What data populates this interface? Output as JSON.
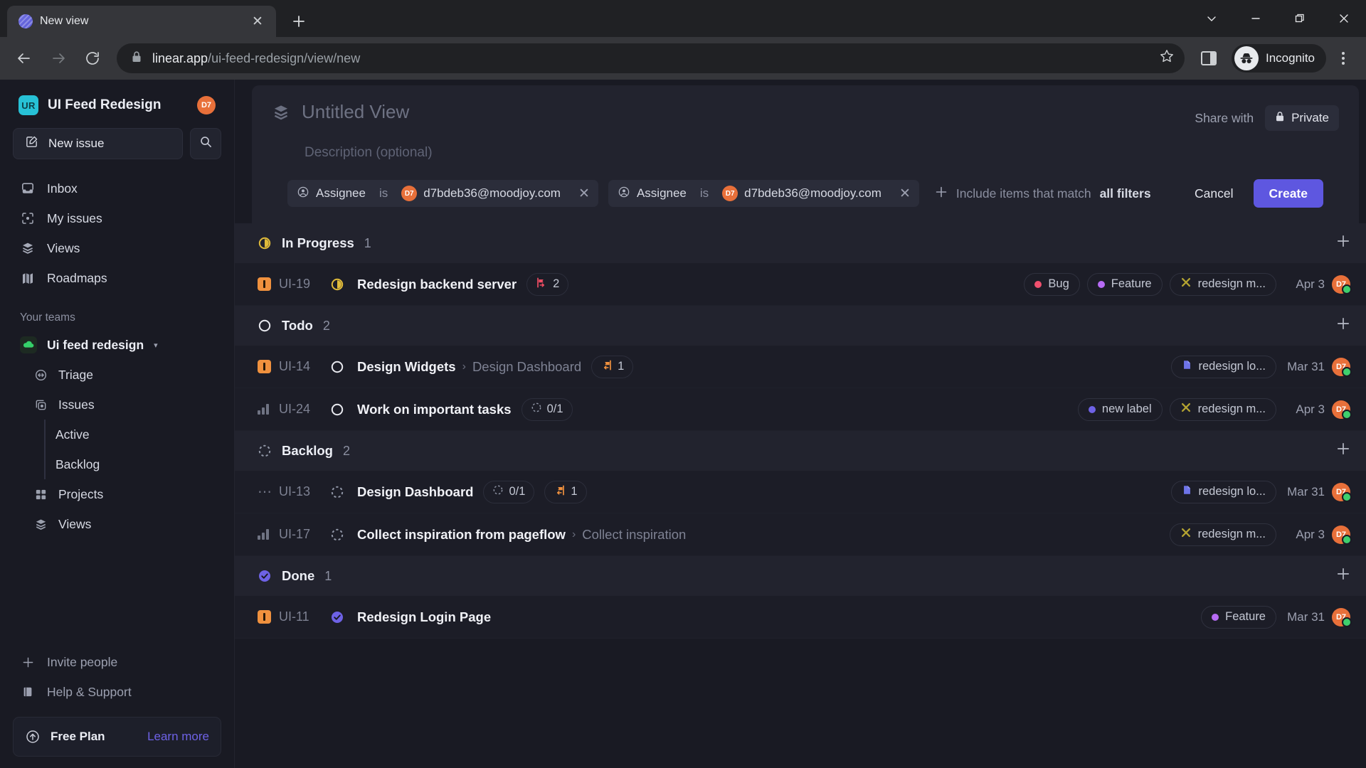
{
  "browser": {
    "tab": {
      "title": "New view",
      "favicon": "linear-favicon-icon",
      "close": "close-icon"
    },
    "newtab_label": "+",
    "window_controls": [
      "chevron-down-icon",
      "minimize-icon",
      "restore-icon",
      "close-icon"
    ],
    "url_domain": "linear.app",
    "url_path": "/ui-feed-redesign/view/new",
    "profile_label": "Incognito",
    "lock_icon": "lock-icon",
    "star_icon": "bookmark-star-icon",
    "side_panel_icon": "side-panel-icon",
    "menu_icon": "kebab-menu-icon"
  },
  "sidebar": {
    "workspace": {
      "initials": "UR",
      "name": "UI Feed Redesign",
      "avatar_initials": "D7"
    },
    "new_issue_label": "New issue",
    "search_icon": "search-icon",
    "nav": [
      {
        "label": "Inbox",
        "icon": "inbox-icon"
      },
      {
        "label": "My issues",
        "icon": "my-issues-icon"
      },
      {
        "label": "Views",
        "icon": "layers-icon"
      },
      {
        "label": "Roadmaps",
        "icon": "roadmap-icon"
      }
    ],
    "teams_label": "Your teams",
    "team": {
      "name": "Ui feed redesign",
      "icon": "team-cloud-icon",
      "caret": "chevron-down-icon"
    },
    "team_items": [
      {
        "label": "Triage",
        "icon": "triage-icon"
      },
      {
        "label": "Issues",
        "icon": "issues-icon"
      }
    ],
    "issue_children": [
      {
        "label": "Active"
      },
      {
        "label": "Backlog"
      }
    ],
    "team_items_2": [
      {
        "label": "Projects",
        "icon": "projects-icon"
      },
      {
        "label": "Views",
        "icon": "layers-icon"
      }
    ],
    "footer": [
      {
        "label": "Invite people",
        "icon": "plus-icon"
      },
      {
        "label": "Help & Support",
        "icon": "book-icon"
      }
    ],
    "plan": {
      "name": "Free Plan",
      "link": "Learn more",
      "icon": "upgrade-arrow-icon"
    }
  },
  "view_card": {
    "title_placeholder": "Untitled View",
    "description_placeholder": "Description (optional)",
    "layers_icon": "layers-icon",
    "share_with_label": "Share with",
    "privacy_label": "Private",
    "privacy_icon": "lock-icon"
  },
  "filter_bar": {
    "filters": [
      {
        "field": "Assignee",
        "operator": "is",
        "value": "d7bdeb36@moodjoy.com",
        "avatar_initials": "D7",
        "field_icon": "user-circle-icon",
        "remove_icon": "close-icon"
      },
      {
        "field": "Assignee",
        "operator": "is",
        "value": "d7bdeb36@moodjoy.com",
        "avatar_initials": "D7",
        "field_icon": "user-circle-icon",
        "remove_icon": "close-icon"
      }
    ],
    "add_icon": "plus-icon",
    "add_prefix": "Include items that match",
    "add_emphasis": "all filters",
    "cancel_label": "Cancel",
    "create_label": "Create"
  },
  "groups": [
    {
      "name": "In Progress",
      "count": "1",
      "state": "in-progress",
      "add_icon": "plus-icon",
      "issues": [
        {
          "priority": "urgent",
          "id": "UI-19",
          "state": "in-progress",
          "title": "Redesign backend server",
          "parent": "",
          "badges": [
            {
              "type": "sub-issues",
              "icon": "sub-issue-red-icon",
              "text": "2"
            }
          ],
          "labels": [
            {
              "text": "Bug",
              "dot": "#f0506e",
              "icon": "dot"
            },
            {
              "text": "Feature",
              "dot": "#b76bf5",
              "icon": "dot"
            },
            {
              "text": "redesign m...",
              "dot": "",
              "icon": "project-cross-icon"
            }
          ],
          "date": "Apr 3",
          "avatar_initials": "D7"
        }
      ]
    },
    {
      "name": "Todo",
      "count": "2",
      "state": "todo",
      "add_icon": "plus-icon",
      "issues": [
        {
          "priority": "urgent",
          "id": "UI-14",
          "state": "todo",
          "title": "Design Widgets",
          "parent": "Design Dashboard",
          "badges": [
            {
              "type": "parent-issue",
              "icon": "parent-issue-orange-icon",
              "text": "1"
            }
          ],
          "labels": [
            {
              "text": "redesign lo...",
              "dot": "",
              "icon": "project-doc-icon"
            }
          ],
          "date": "Mar 31",
          "avatar_initials": "D7"
        },
        {
          "priority": "medium",
          "id": "UI-24",
          "state": "todo",
          "title": "Work on important tasks",
          "parent": "",
          "badges": [
            {
              "type": "progress",
              "icon": "progress-circle-icon",
              "text": "0/1"
            }
          ],
          "labels": [
            {
              "text": "new label",
              "dot": "#6e62e6",
              "icon": "dot"
            },
            {
              "text": "redesign m...",
              "dot": "",
              "icon": "project-cross-icon"
            }
          ],
          "date": "Apr 3",
          "avatar_initials": "D7"
        }
      ]
    },
    {
      "name": "Backlog",
      "count": "2",
      "state": "backlog",
      "add_icon": "plus-icon",
      "issues": [
        {
          "priority": "none",
          "id": "UI-13",
          "state": "backlog",
          "title": "Design Dashboard",
          "parent": "",
          "badges": [
            {
              "type": "progress",
              "icon": "progress-circle-icon",
              "text": "0/1"
            },
            {
              "type": "parent-issue",
              "icon": "parent-issue-orange-icon",
              "text": "1"
            }
          ],
          "labels": [
            {
              "text": "redesign lo...",
              "dot": "",
              "icon": "project-doc-icon"
            }
          ],
          "date": "Mar 31",
          "avatar_initials": "D7"
        },
        {
          "priority": "medium",
          "id": "UI-17",
          "state": "backlog",
          "title": "Collect inspiration from pageflow",
          "parent": "Collect inspiration",
          "badges": [],
          "labels": [
            {
              "text": "redesign m...",
              "dot": "",
              "icon": "project-cross-icon"
            }
          ],
          "date": "Apr 3",
          "avatar_initials": "D7"
        }
      ]
    },
    {
      "name": "Done",
      "count": "1",
      "state": "done",
      "add_icon": "plus-icon",
      "issues": [
        {
          "priority": "urgent",
          "id": "UI-11",
          "state": "done",
          "title": "Redesign Login Page",
          "parent": "",
          "badges": [],
          "labels": [
            {
              "text": "Feature",
              "dot": "#b76bf5",
              "icon": "dot"
            }
          ],
          "date": "Mar 31",
          "avatar_initials": "D7"
        }
      ]
    }
  ],
  "colors": {
    "accent": "#5e57e0",
    "urgent": "#f0913e",
    "in_progress": "#e0bb3a",
    "done": "#6e62e6",
    "avatar": "#e8703a",
    "online": "#3fcf6d"
  }
}
